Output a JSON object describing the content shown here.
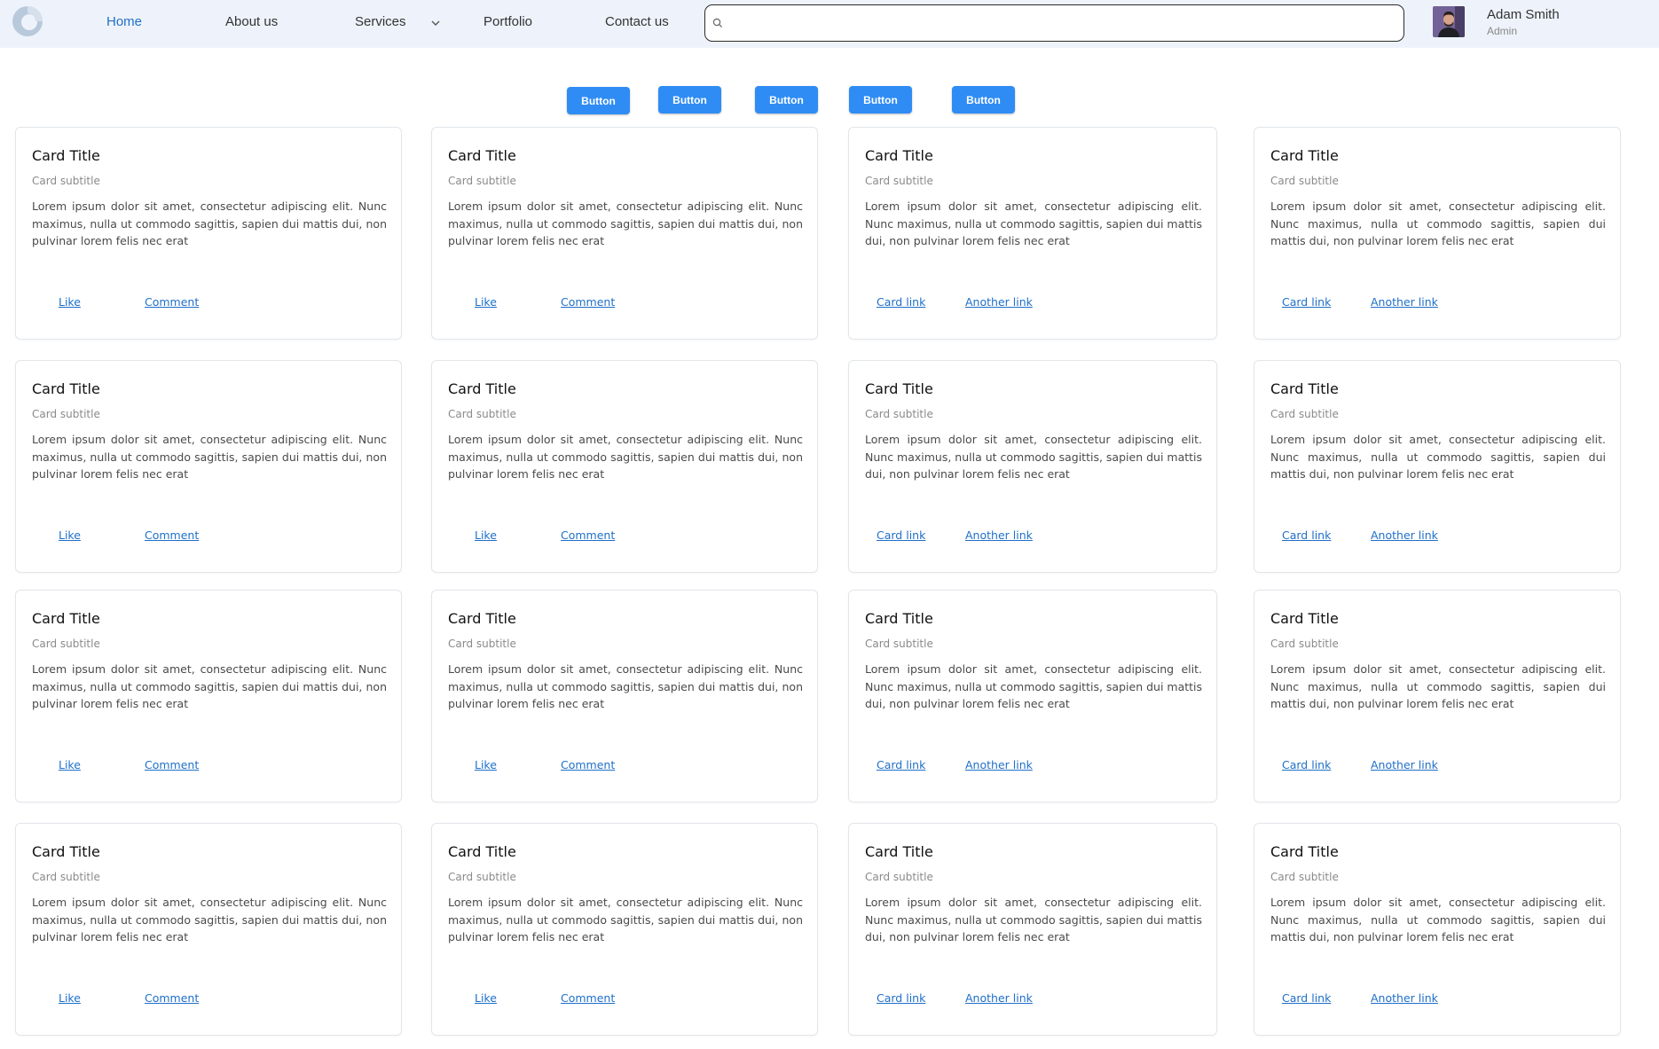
{
  "nav": {
    "items": [
      {
        "label": "Home",
        "active": true
      },
      {
        "label": "About us",
        "active": false
      },
      {
        "label": "Services",
        "active": false,
        "has_dropdown": true
      },
      {
        "label": "Portfolio",
        "active": false
      },
      {
        "label": "Contact us",
        "active": false
      }
    ],
    "search": {
      "value": "",
      "placeholder": ""
    },
    "user": {
      "name": "Adam Smith",
      "role": "Admin"
    }
  },
  "buttons": [
    "Button",
    "Button",
    "Button",
    "Button",
    "Button"
  ],
  "colors": {
    "accent": "#2f8cf4",
    "nav_background": "#eef3fb",
    "link": "#1f6fc9"
  },
  "cards": [
    {
      "title": "Card Title",
      "subtitle": "Card subtitle",
      "text": "Lorem ipsum dolor sit amet, consectetur adipiscing elit. Nunc maximus, nulla ut commodo sagittis, sapien dui mattis dui, non pulvinar lorem felis nec erat",
      "links": [
        "Like",
        "Comment"
      ]
    },
    {
      "title": "Card Title",
      "subtitle": "Card subtitle",
      "text": "Lorem ipsum dolor sit amet, consectetur adipiscing elit. Nunc maximus, nulla ut commodo sagittis, sapien dui mattis dui, non pulvinar lorem felis nec erat",
      "links": [
        "Like",
        "Comment"
      ]
    },
    {
      "title": "Card Title",
      "subtitle": "Card subtitle",
      "text": "Lorem ipsum dolor sit amet, consectetur adipiscing elit. Nunc maximus, nulla ut commodo sagittis, sapien dui mattis dui, non pulvinar lorem felis nec erat",
      "links": [
        "Card link",
        "Another link"
      ]
    },
    {
      "title": "Card Title",
      "subtitle": "Card subtitle",
      "text": "Lorem ipsum dolor sit amet, consectetur adipiscing elit. Nunc maximus, nulla ut commodo sagittis, sapien dui mattis dui, non pulvinar lorem felis nec erat",
      "links": [
        "Card link",
        "Another link"
      ]
    },
    {
      "title": "Card Title",
      "subtitle": "Card subtitle",
      "text": "Lorem ipsum dolor sit amet, consectetur adipiscing elit. Nunc maximus, nulla ut commodo sagittis, sapien dui mattis dui, non pulvinar lorem felis nec erat",
      "links": [
        "Like",
        "Comment"
      ]
    },
    {
      "title": "Card Title",
      "subtitle": "Card subtitle",
      "text": "Lorem ipsum dolor sit amet, consectetur adipiscing elit. Nunc maximus, nulla ut commodo sagittis, sapien dui mattis dui, non pulvinar lorem felis nec erat",
      "links": [
        "Like",
        "Comment"
      ]
    },
    {
      "title": "Card Title",
      "subtitle": "Card subtitle",
      "text": "Lorem ipsum dolor sit amet, consectetur adipiscing elit. Nunc maximus, nulla ut commodo sagittis, sapien dui mattis dui, non pulvinar lorem felis nec erat",
      "links": [
        "Card link",
        "Another link"
      ]
    },
    {
      "title": "Card Title",
      "subtitle": "Card subtitle",
      "text": "Lorem ipsum dolor sit amet, consectetur adipiscing elit. Nunc maximus, nulla ut commodo sagittis, sapien dui mattis dui, non pulvinar lorem felis nec erat",
      "links": [
        "Card link",
        "Another link"
      ]
    },
    {
      "title": "Card Title",
      "subtitle": "Card subtitle",
      "text": "Lorem ipsum dolor sit amet, consectetur adipiscing elit. Nunc maximus, nulla ut commodo sagittis, sapien dui mattis dui, non pulvinar lorem felis nec erat",
      "links": [
        "Like",
        "Comment"
      ]
    },
    {
      "title": "Card Title",
      "subtitle": "Card subtitle",
      "text": "Lorem ipsum dolor sit amet, consectetur adipiscing elit. Nunc maximus, nulla ut commodo sagittis, sapien dui mattis dui, non pulvinar lorem felis nec erat",
      "links": [
        "Like",
        "Comment"
      ]
    },
    {
      "title": "Card Title",
      "subtitle": "Card subtitle",
      "text": "Lorem ipsum dolor sit amet, consectetur adipiscing elit. Nunc maximus, nulla ut commodo sagittis, sapien dui mattis dui, non pulvinar lorem felis nec erat",
      "links": [
        "Card link",
        "Another link"
      ]
    },
    {
      "title": "Card Title",
      "subtitle": "Card subtitle",
      "text": "Lorem ipsum dolor sit amet, consectetur adipiscing elit. Nunc maximus, nulla ut commodo sagittis, sapien dui mattis dui, non pulvinar lorem felis nec erat",
      "links": [
        "Card link",
        "Another link"
      ]
    },
    {
      "title": "Card Title",
      "subtitle": "Card subtitle",
      "text": "Lorem ipsum dolor sit amet, consectetur adipiscing elit. Nunc maximus, nulla ut commodo sagittis, sapien dui mattis dui, non pulvinar lorem felis nec erat",
      "links": [
        "Like",
        "Comment"
      ]
    },
    {
      "title": "Card Title",
      "subtitle": "Card subtitle",
      "text": "Lorem ipsum dolor sit amet, consectetur adipiscing elit. Nunc maximus, nulla ut commodo sagittis, sapien dui mattis dui, non pulvinar lorem felis nec erat",
      "links": [
        "Like",
        "Comment"
      ]
    },
    {
      "title": "Card Title",
      "subtitle": "Card subtitle",
      "text": "Lorem ipsum dolor sit amet, consectetur adipiscing elit. Nunc maximus, nulla ut commodo sagittis, sapien dui mattis dui, non pulvinar lorem felis nec erat",
      "links": [
        "Card link",
        "Another link"
      ]
    },
    {
      "title": "Card Title",
      "subtitle": "Card subtitle",
      "text": "Lorem ipsum dolor sit amet, consectetur adipiscing elit. Nunc maximus, nulla ut commodo sagittis, sapien dui mattis dui, non pulvinar lorem felis nec erat",
      "links": [
        "Card link",
        "Another link"
      ]
    }
  ]
}
